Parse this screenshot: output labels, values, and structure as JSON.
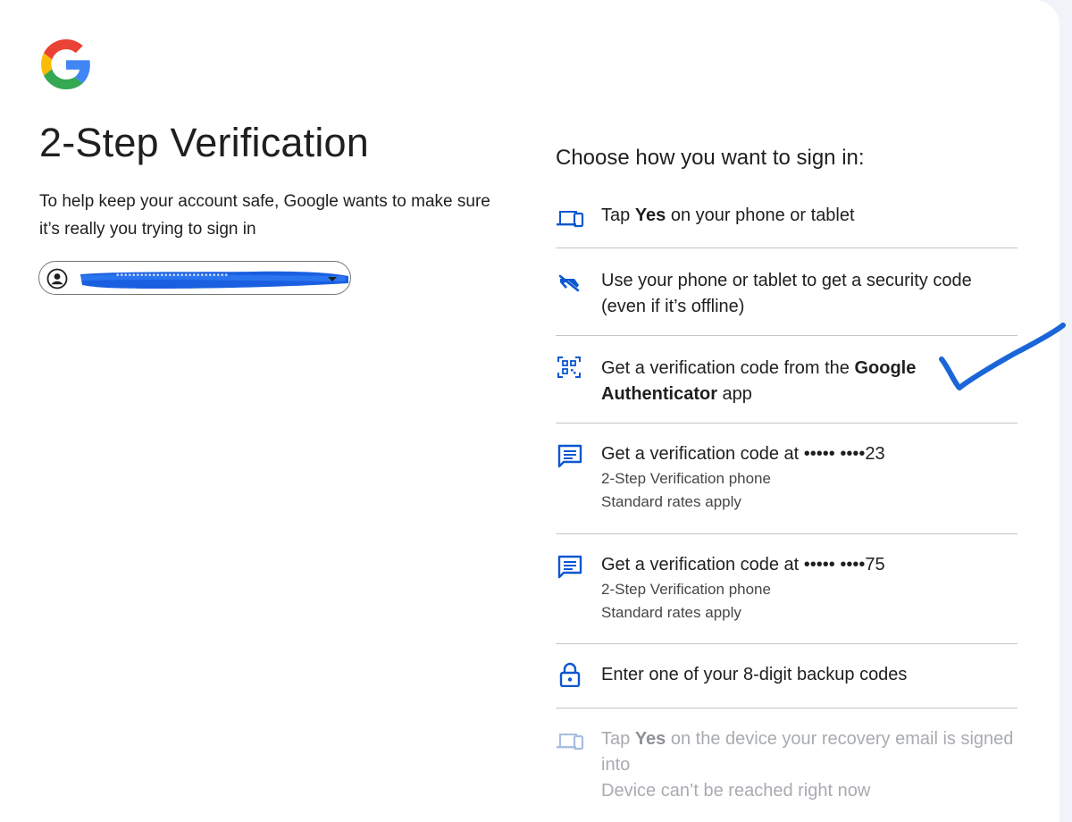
{
  "page": {
    "title": "2-Step Verification",
    "subtitle": "To help keep your account safe, Google wants to make sure it’s really you trying to sign in",
    "logo_icon": "google-g-logo",
    "brand_colors": {
      "blue": "#4285F4",
      "red": "#EA4335",
      "yellow": "#FBBC05",
      "green": "#34A853"
    }
  },
  "account": {
    "email": "••••••••••••••••••••••••••••",
    "avatar_icon": "account-circle-icon",
    "caret_icon": "arrow-drop-down-icon"
  },
  "choices": {
    "heading": "Choose how you want to sign in:",
    "accent_color": "#0b57d0",
    "options": [
      {
        "icon": "devices-icon",
        "prefix": "Tap ",
        "bold": "Yes",
        "suffix": " on your phone or tablet"
      },
      {
        "icon": "phonelink-off-icon",
        "text": "Use your phone or tablet to get a security code (even if it’s offline)"
      },
      {
        "icon": "qr-code-scanner-icon",
        "prefix": "Get a verification code from the ",
        "bold": "Google Authenticator",
        "suffix": " app"
      },
      {
        "icon": "sms-icon",
        "text": "Get a verification code at ••••• ••••23",
        "sub1": "2-Step Verification phone",
        "sub2": "Standard rates apply"
      },
      {
        "icon": "sms-icon",
        "text": "Get a verification code at ••••• ••••75",
        "sub1": "2-Step Verification phone",
        "sub2": "Standard rates apply"
      },
      {
        "icon": "lock-icon",
        "text": "Enter one of your 8-digit backup codes"
      },
      {
        "icon": "devices-icon",
        "prefix": "Tap ",
        "bold": "Yes",
        "suffix": " on the device your recovery email is signed into",
        "sub1": "Device can’t be reached right now",
        "disabled": true
      }
    ]
  },
  "annotation": {
    "type": "handwritten-checkmark",
    "color": "#1a66d9"
  }
}
